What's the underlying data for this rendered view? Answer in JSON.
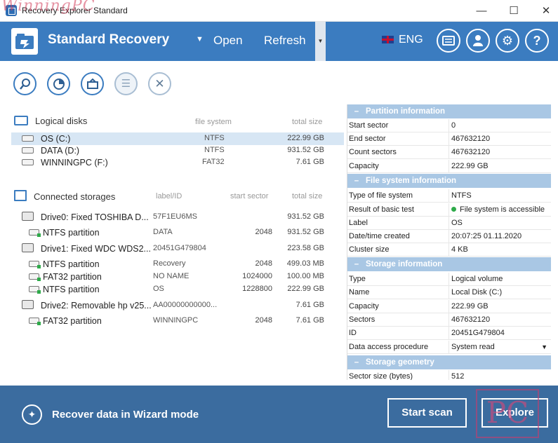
{
  "window": {
    "title": "Recovery Explorer Standard",
    "watermark": "WinningPC",
    "minimize": "—",
    "maximize": "☐",
    "close": "✕"
  },
  "header": {
    "brand": "Standard Recovery",
    "open": "Open",
    "refresh": "Refresh",
    "language": "ENG",
    "icons": [
      "message-icon",
      "user-icon",
      "gear-icon",
      "help-icon"
    ],
    "help_glyph": "?"
  },
  "toolbar": {
    "icons": [
      "search-icon",
      "scan-icon",
      "image-icon",
      "list-icon",
      "close-icon"
    ]
  },
  "logical_disks": {
    "title": "Logical disks",
    "col_fs": "file system",
    "col_size": "total size",
    "items": [
      {
        "name": "OS (C:)",
        "fs": "NTFS",
        "size": "222.99 GB"
      },
      {
        "name": "DATA (D:)",
        "fs": "NTFS",
        "size": "931.52 GB"
      },
      {
        "name": "WINNINGPC (F:)",
        "fs": "FAT32",
        "size": "7.61 GB"
      }
    ]
  },
  "storages": {
    "title": "Connected storages",
    "col_label": "label/ID",
    "col_sector": "start sector",
    "col_size": "total size",
    "items": [
      {
        "name": "Drive0: Fixed TOSHIBA D...",
        "label": "57F1EU6MS",
        "sector": "",
        "size": "931.52 GB"
      },
      {
        "name": "NTFS partition",
        "label": "DATA",
        "sector": "2048",
        "size": "931.52 GB"
      },
      {
        "name": "Drive1: Fixed WDC WDS2...",
        "label": "20451G479804",
        "sector": "",
        "size": "223.58 GB"
      },
      {
        "name": "NTFS partition",
        "label": "Recovery",
        "sector": "2048",
        "size": "499.03 MB"
      },
      {
        "name": "FAT32 partition",
        "label": "NO NAME",
        "sector": "1024000",
        "size": "100.00 MB"
      },
      {
        "name": "NTFS partition",
        "label": "OS",
        "sector": "1228800",
        "size": "222.99 GB"
      },
      {
        "name": "Drive2: Removable hp v25...",
        "label": "AA00000000000...",
        "sector": "",
        "size": "7.61 GB"
      },
      {
        "name": "FAT32 partition",
        "label": "WINNINGPC",
        "sector": "2048",
        "size": "7.61 GB"
      }
    ]
  },
  "properties": {
    "dash": "–",
    "partition": {
      "title": "Partition information",
      "rows": [
        {
          "k": "Start sector",
          "v": "0"
        },
        {
          "k": "End sector",
          "v": "467632120"
        },
        {
          "k": "Count sectors",
          "v": "467632120"
        },
        {
          "k": "Capacity",
          "v": "222.99 GB"
        }
      ]
    },
    "filesystem": {
      "title": "File system information",
      "rows": [
        {
          "k": "Type of file system",
          "v": "NTFS"
        },
        {
          "k": "Result of basic test",
          "v": "File system is accessible"
        },
        {
          "k": "Label",
          "v": "OS"
        },
        {
          "k": "Date/time created",
          "v": "20:07:25 01.11.2020"
        },
        {
          "k": "Cluster size",
          "v": "4 KB"
        }
      ]
    },
    "storage": {
      "title": "Storage information",
      "rows": [
        {
          "k": "Type",
          "v": "Logical volume"
        },
        {
          "k": "Name",
          "v": "Local Disk (C:)"
        },
        {
          "k": "Capacity",
          "v": "222.99 GB"
        },
        {
          "k": "Sectors",
          "v": "467632120"
        },
        {
          "k": "ID",
          "v": "20451G479804"
        },
        {
          "k": "Data access procedure",
          "v": "System read"
        }
      ]
    },
    "geometry": {
      "title": "Storage geometry",
      "rows": [
        {
          "k": "Sector size (bytes)",
          "v": "512"
        }
      ]
    }
  },
  "bottom": {
    "wizard": "Recover data in Wizard mode",
    "start_scan": "Start scan",
    "explore": "Explore",
    "pc_mark": "PC"
  },
  "colors": {
    "accent": "#3b7cc0",
    "bottom_bar": "#3b6c9f",
    "panel_header": "#a9c7e4",
    "selection": "#d7e6f4",
    "ok_green": "#2eaa4a"
  }
}
